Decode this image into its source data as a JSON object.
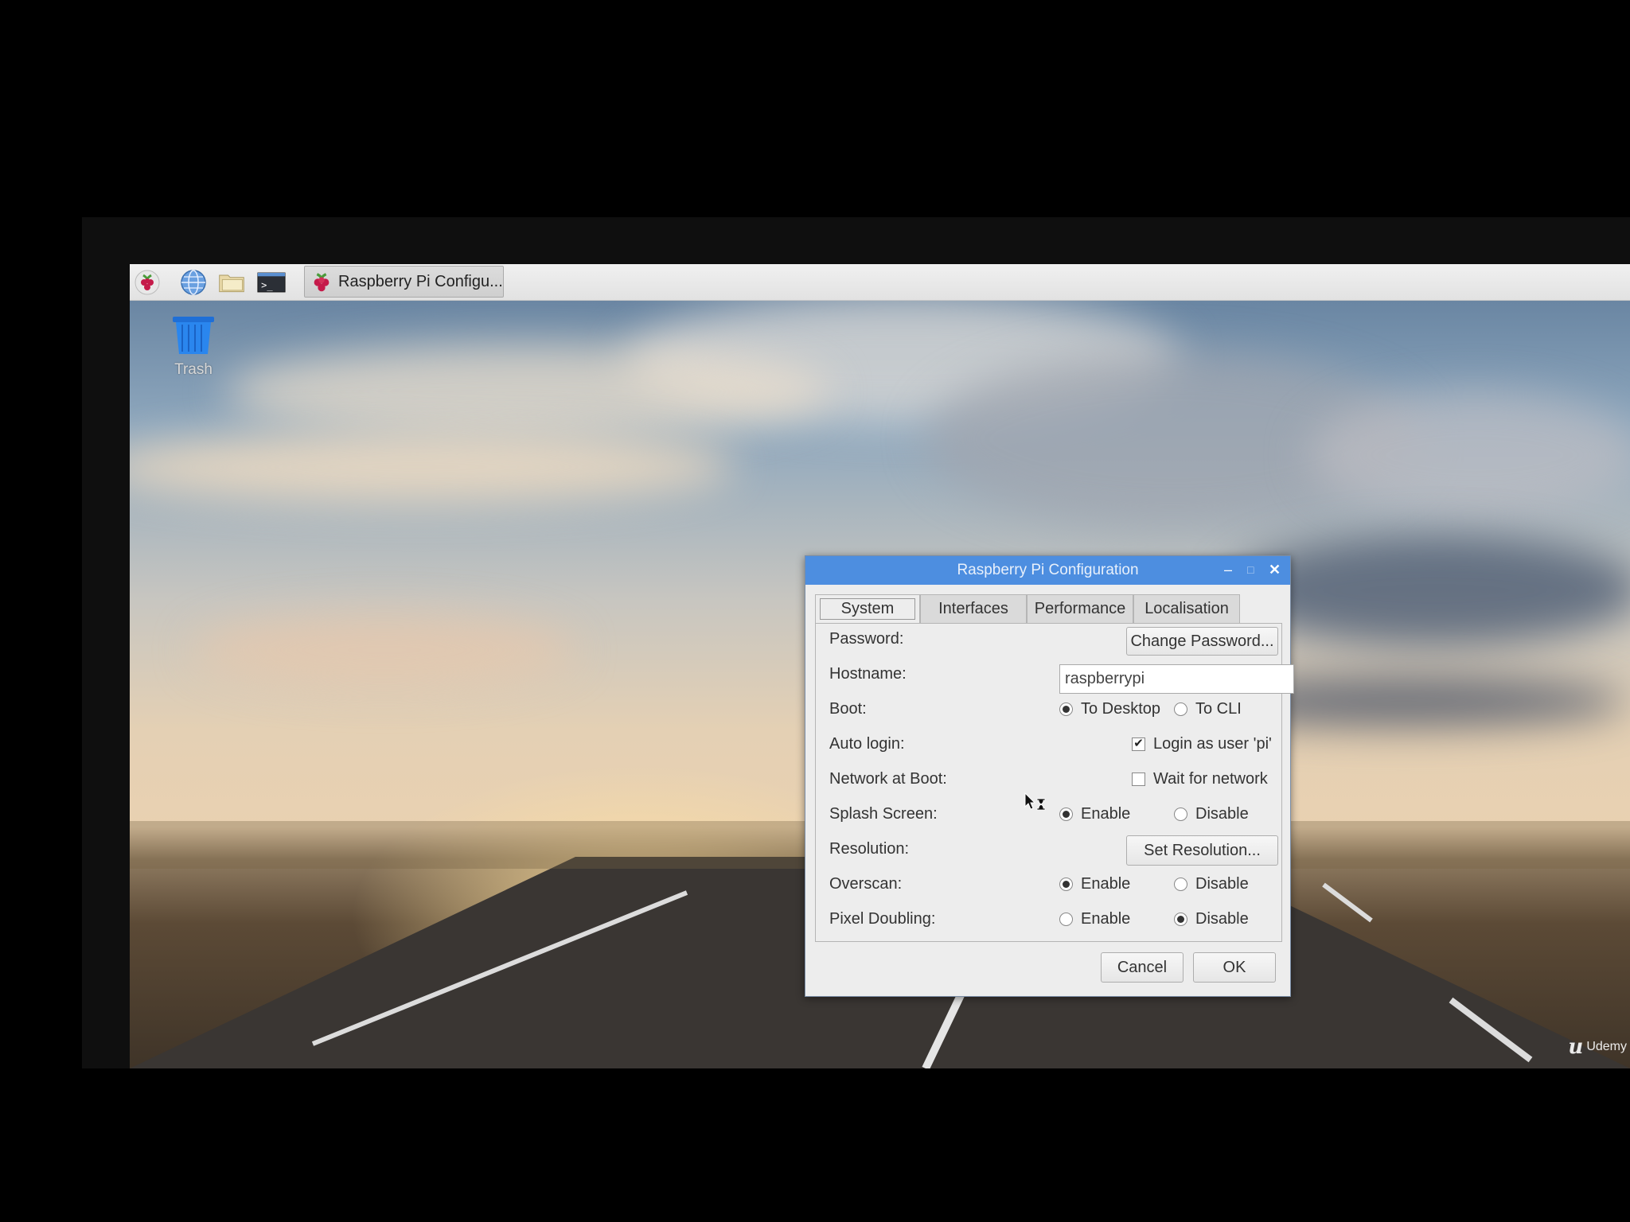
{
  "taskbar": {
    "icons": [
      "raspberry-menu-icon",
      "web-browser-icon",
      "file-manager-icon",
      "terminal-icon"
    ],
    "app_button_label": "Raspberry Pi Configu..."
  },
  "desktop": {
    "trash_label": "Trash",
    "watermark": "Udemy"
  },
  "dialog": {
    "title": "Raspberry Pi Configuration",
    "tabs": [
      "System",
      "Interfaces",
      "Performance",
      "Localisation"
    ],
    "active_tab": "System",
    "rows": {
      "password_label": "Password:",
      "change_password_button": "Change Password...",
      "hostname_label": "Hostname:",
      "hostname_value": "raspberrypi",
      "boot_label": "Boot:",
      "boot_desktop": "To Desktop",
      "boot_cli": "To CLI",
      "autologin_label": "Auto login:",
      "autologin_option": "Login as user 'pi'",
      "network_label": "Network at Boot:",
      "network_option": "Wait for network",
      "splash_label": "Splash Screen:",
      "resolution_label": "Resolution:",
      "set_resolution_button": "Set Resolution...",
      "overscan_label": "Overscan:",
      "pixel_doubling_label": "Pixel Doubling:",
      "enable": "Enable",
      "disable": "Disable"
    },
    "state": {
      "boot": "To Desktop",
      "autologin": true,
      "wait_for_network": false,
      "splash": "Enable",
      "overscan": "Enable",
      "pixel_doubling": "Disable"
    },
    "cancel_button": "Cancel",
    "ok_button": "OK"
  },
  "colors": {
    "titlebar": "#4d8ee0",
    "dialog_bg": "#ededed"
  }
}
